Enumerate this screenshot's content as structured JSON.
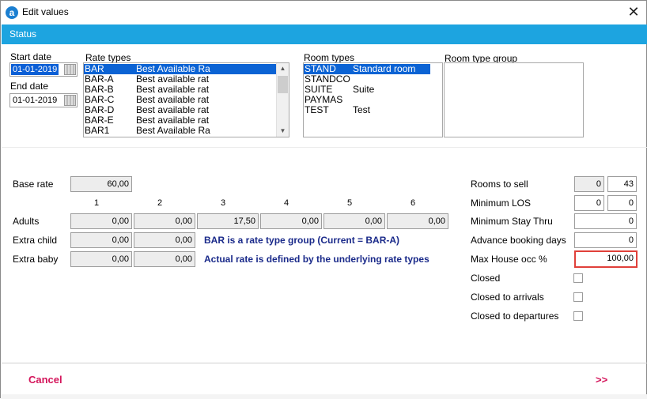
{
  "window": {
    "title": "Edit values",
    "close_glyph": "✕",
    "app_icon_letter": "a"
  },
  "status_label": "Status",
  "dates": {
    "start_label": "Start date",
    "start_value": "01-01-2019",
    "end_label": "End date",
    "end_value": "01-01-2019"
  },
  "rate_types": {
    "header": "Rate types",
    "items": [
      {
        "code": "BAR",
        "name": "Best Available Ra",
        "selected": true
      },
      {
        "code": "BAR-A",
        "name": "Best available rat"
      },
      {
        "code": "BAR-B",
        "name": "Best available rat"
      },
      {
        "code": "BAR-C",
        "name": "Best available rat"
      },
      {
        "code": "BAR-D",
        "name": "Best available rat"
      },
      {
        "code": "BAR-E",
        "name": "Best available rat"
      },
      {
        "code": "BAR1",
        "name": "Best Available Ra"
      }
    ]
  },
  "room_types": {
    "header": "Room types",
    "items": [
      {
        "code": "STAND",
        "name": "Standard room",
        "selected": true
      },
      {
        "code": "STANDCO",
        "name": ""
      },
      {
        "code": "SUITE",
        "name": "Suite"
      },
      {
        "code": "PAYMAS",
        "name": ""
      },
      {
        "code": "TEST",
        "name": "Test"
      }
    ]
  },
  "room_type_group": {
    "header": "Room type group"
  },
  "rates": {
    "base_rate_label": "Base rate",
    "base_rate_value": "60,00",
    "columns": [
      "1",
      "2",
      "3",
      "4",
      "5",
      "6"
    ],
    "adults_label": "Adults",
    "adults_values": [
      "0,00",
      "0,00",
      "17,50",
      "0,00",
      "0,00",
      "0,00"
    ],
    "extra_child_label": "Extra child",
    "extra_child_values": [
      "0,00",
      "0,00"
    ],
    "extra_baby_label": "Extra baby",
    "extra_baby_values": [
      "0,00",
      "0,00"
    ],
    "info_line1": "BAR is a rate type group (Current = BAR-A)",
    "info_line2": "Actual rate is defined by the underlying rate types"
  },
  "restrictions": {
    "rooms_to_sell_label": "Rooms to sell",
    "rooms_to_sell_a": "0",
    "rooms_to_sell_b": "43",
    "min_los_label": "Minimum LOS",
    "min_los_a": "0",
    "min_los_b": "0",
    "min_stay_thru_label": "Minimum Stay Thru",
    "min_stay_thru_value": "0",
    "advance_booking_label": "Advance booking days",
    "advance_booking_value": "0",
    "max_house_occ_label": "Max House occ %",
    "max_house_occ_value": "100,00",
    "closed_label": "Closed",
    "closed_arrivals_label": "Closed to arrivals",
    "closed_departures_label": "Closed to departures"
  },
  "footer": {
    "cancel_label": "Cancel",
    "next_label": ">>"
  },
  "colors": {
    "status_bar": "#1da4e0",
    "selection": "#0b63d4",
    "footer_buttons": "#d4145a",
    "info_text": "#1a2a8a",
    "highlight_border": "#e0403a"
  }
}
